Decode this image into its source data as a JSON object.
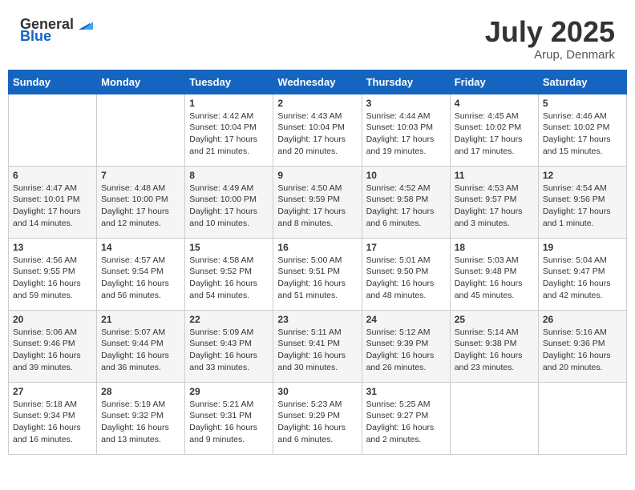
{
  "header": {
    "logo_general": "General",
    "logo_blue": "Blue",
    "month_year": "July 2025",
    "location": "Arup, Denmark"
  },
  "weekdays": [
    "Sunday",
    "Monday",
    "Tuesday",
    "Wednesday",
    "Thursday",
    "Friday",
    "Saturday"
  ],
  "weeks": [
    [
      {
        "day": "",
        "info": ""
      },
      {
        "day": "",
        "info": ""
      },
      {
        "day": "1",
        "info": "Sunrise: 4:42 AM\nSunset: 10:04 PM\nDaylight: 17 hours and 21 minutes."
      },
      {
        "day": "2",
        "info": "Sunrise: 4:43 AM\nSunset: 10:04 PM\nDaylight: 17 hours and 20 minutes."
      },
      {
        "day": "3",
        "info": "Sunrise: 4:44 AM\nSunset: 10:03 PM\nDaylight: 17 hours and 19 minutes."
      },
      {
        "day": "4",
        "info": "Sunrise: 4:45 AM\nSunset: 10:02 PM\nDaylight: 17 hours and 17 minutes."
      },
      {
        "day": "5",
        "info": "Sunrise: 4:46 AM\nSunset: 10:02 PM\nDaylight: 17 hours and 15 minutes."
      }
    ],
    [
      {
        "day": "6",
        "info": "Sunrise: 4:47 AM\nSunset: 10:01 PM\nDaylight: 17 hours and 14 minutes."
      },
      {
        "day": "7",
        "info": "Sunrise: 4:48 AM\nSunset: 10:00 PM\nDaylight: 17 hours and 12 minutes."
      },
      {
        "day": "8",
        "info": "Sunrise: 4:49 AM\nSunset: 10:00 PM\nDaylight: 17 hours and 10 minutes."
      },
      {
        "day": "9",
        "info": "Sunrise: 4:50 AM\nSunset: 9:59 PM\nDaylight: 17 hours and 8 minutes."
      },
      {
        "day": "10",
        "info": "Sunrise: 4:52 AM\nSunset: 9:58 PM\nDaylight: 17 hours and 6 minutes."
      },
      {
        "day": "11",
        "info": "Sunrise: 4:53 AM\nSunset: 9:57 PM\nDaylight: 17 hours and 3 minutes."
      },
      {
        "day": "12",
        "info": "Sunrise: 4:54 AM\nSunset: 9:56 PM\nDaylight: 17 hours and 1 minute."
      }
    ],
    [
      {
        "day": "13",
        "info": "Sunrise: 4:56 AM\nSunset: 9:55 PM\nDaylight: 16 hours and 59 minutes."
      },
      {
        "day": "14",
        "info": "Sunrise: 4:57 AM\nSunset: 9:54 PM\nDaylight: 16 hours and 56 minutes."
      },
      {
        "day": "15",
        "info": "Sunrise: 4:58 AM\nSunset: 9:52 PM\nDaylight: 16 hours and 54 minutes."
      },
      {
        "day": "16",
        "info": "Sunrise: 5:00 AM\nSunset: 9:51 PM\nDaylight: 16 hours and 51 minutes."
      },
      {
        "day": "17",
        "info": "Sunrise: 5:01 AM\nSunset: 9:50 PM\nDaylight: 16 hours and 48 minutes."
      },
      {
        "day": "18",
        "info": "Sunrise: 5:03 AM\nSunset: 9:48 PM\nDaylight: 16 hours and 45 minutes."
      },
      {
        "day": "19",
        "info": "Sunrise: 5:04 AM\nSunset: 9:47 PM\nDaylight: 16 hours and 42 minutes."
      }
    ],
    [
      {
        "day": "20",
        "info": "Sunrise: 5:06 AM\nSunset: 9:46 PM\nDaylight: 16 hours and 39 minutes."
      },
      {
        "day": "21",
        "info": "Sunrise: 5:07 AM\nSunset: 9:44 PM\nDaylight: 16 hours and 36 minutes."
      },
      {
        "day": "22",
        "info": "Sunrise: 5:09 AM\nSunset: 9:43 PM\nDaylight: 16 hours and 33 minutes."
      },
      {
        "day": "23",
        "info": "Sunrise: 5:11 AM\nSunset: 9:41 PM\nDaylight: 16 hours and 30 minutes."
      },
      {
        "day": "24",
        "info": "Sunrise: 5:12 AM\nSunset: 9:39 PM\nDaylight: 16 hours and 26 minutes."
      },
      {
        "day": "25",
        "info": "Sunrise: 5:14 AM\nSunset: 9:38 PM\nDaylight: 16 hours and 23 minutes."
      },
      {
        "day": "26",
        "info": "Sunrise: 5:16 AM\nSunset: 9:36 PM\nDaylight: 16 hours and 20 minutes."
      }
    ],
    [
      {
        "day": "27",
        "info": "Sunrise: 5:18 AM\nSunset: 9:34 PM\nDaylight: 16 hours and 16 minutes."
      },
      {
        "day": "28",
        "info": "Sunrise: 5:19 AM\nSunset: 9:32 PM\nDaylight: 16 hours and 13 minutes."
      },
      {
        "day": "29",
        "info": "Sunrise: 5:21 AM\nSunset: 9:31 PM\nDaylight: 16 hours and 9 minutes."
      },
      {
        "day": "30",
        "info": "Sunrise: 5:23 AM\nSunset: 9:29 PM\nDaylight: 16 hours and 6 minutes."
      },
      {
        "day": "31",
        "info": "Sunrise: 5:25 AM\nSunset: 9:27 PM\nDaylight: 16 hours and 2 minutes."
      },
      {
        "day": "",
        "info": ""
      },
      {
        "day": "",
        "info": ""
      }
    ]
  ]
}
